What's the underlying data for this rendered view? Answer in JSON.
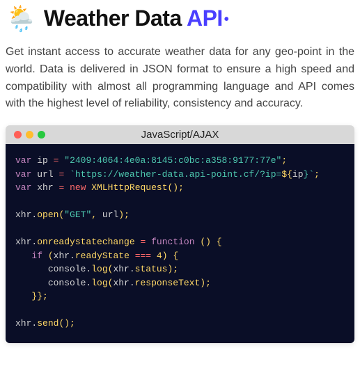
{
  "header": {
    "icon": "🌦️",
    "title_main": "Weather Data ",
    "title_api": "API",
    "title_dot": "•"
  },
  "description": "Get instant access to accurate weather data for any geo-point in the world. Data is delivered in JSON format to ensure a high speed and compatibility with almost all programming language and API comes with the highest level of reliability, consistency and accuracy.",
  "code_window": {
    "title": "JavaScript/AJAX",
    "dots": [
      "red",
      "yellow",
      "green"
    ],
    "code": {
      "ip_var": "ip",
      "ip_value": "\"2409:4064:4e0a:8145:c0bc:a358:9177:77e\"",
      "url_var": "url",
      "url_value_pre": "`https://weather-data.api-point.cf/?ip=",
      "url_value_interp": "${",
      "url_value_ip": "ip",
      "url_value_post": "}`",
      "xhr_var": "xhr",
      "xhr_class": "XMLHttpRequest",
      "open_method": "open",
      "open_arg1": "\"GET\"",
      "open_arg2": "url",
      "orsc": "onreadystatechange",
      "func_kw": "function",
      "if_kw": "if",
      "ready_state": "readyState",
      "four": "4",
      "console": "console",
      "log": "log",
      "status": "status",
      "responseText": "responseText",
      "send": "send",
      "var_kw": "var",
      "new_kw": "new"
    }
  }
}
